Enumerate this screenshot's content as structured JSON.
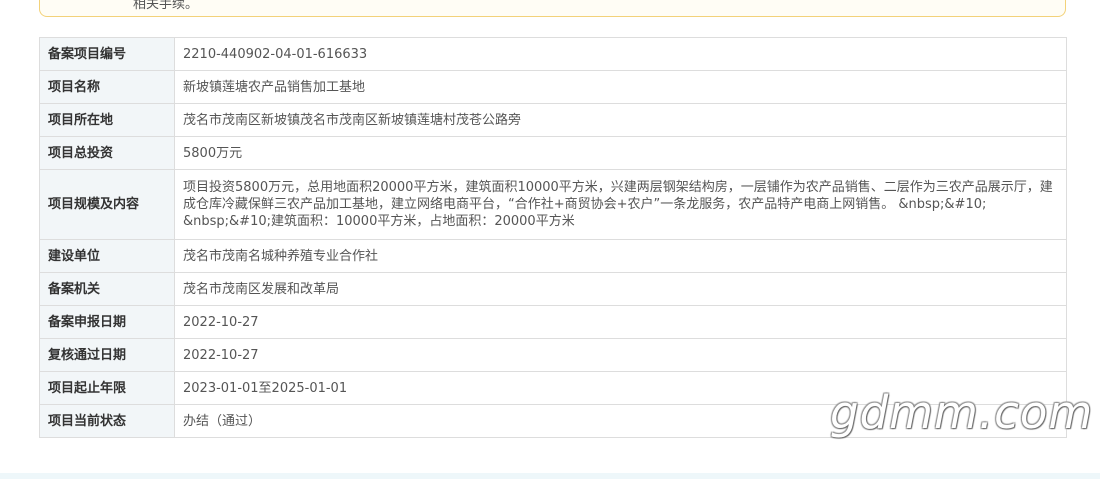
{
  "notice": {
    "text": "相关手续。"
  },
  "rows": [
    {
      "label": "备案项目编号",
      "value": "2210-440902-04-01-616633"
    },
    {
      "label": "项目名称",
      "value": "新坡镇莲塘农产品销售加工基地"
    },
    {
      "label": "项目所在地",
      "value": "茂名市茂南区新坡镇茂名市茂南区新坡镇莲塘村茂苍公路旁"
    },
    {
      "label": "项目总投资",
      "value": "5800万元"
    },
    {
      "label": "项目规模及内容",
      "value": "项目投资5800万元，总用地面积20000平方米，建筑面积10000平方米，兴建两层钢架结构房，一层铺作为农产品销售、二层作为三农产品展示厅，建成仓库冷藏保鲜三农产品加工基地，建立网络电商平台，“合作社+商贸协会+农户”一条龙服务，农产品特产电商上网销售。 &nbsp;&#10; &nbsp;&#10;建筑面积：10000平方米，占地面积：20000平方米"
    },
    {
      "label": "建设单位",
      "value": "茂名市茂南名城种养殖专业合作社"
    },
    {
      "label": "备案机关",
      "value": "茂名市茂南区发展和改革局"
    },
    {
      "label": "备案申报日期",
      "value": "2022-10-27"
    },
    {
      "label": "复核通过日期",
      "value": "2022-10-27"
    },
    {
      "label": "项目起止年限",
      "value": "2023-01-01至2025-01-01"
    },
    {
      "label": "项目当前状态",
      "value": "办结（通过）"
    }
  ],
  "watermark": "gdmm.com"
}
